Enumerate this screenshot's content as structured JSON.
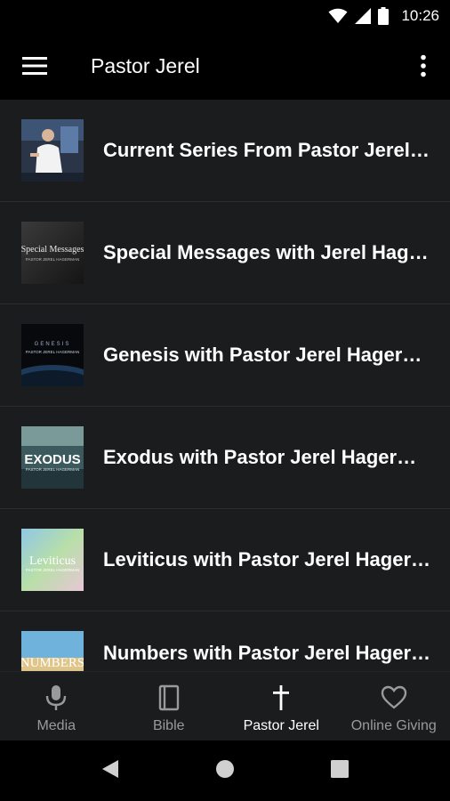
{
  "status_bar": {
    "time": "10:26",
    "icons": [
      "wifi-icon",
      "cell-signal-icon",
      "battery-icon"
    ]
  },
  "app_bar": {
    "title": "Pastor Jerel",
    "menu_icon": "hamburger-menu-icon",
    "overflow_icon": "more-vert-icon"
  },
  "list": {
    "items": [
      {
        "title": "Current Series From Pastor Jerel Hagerman",
        "thumb": "speaker-photo"
      },
      {
        "title": "Special Messages with Jerel Hagerman",
        "thumb": "special-messages-art",
        "thumb_text": "Special Messages",
        "thumb_sub": "PASTOR JEREL HAGERMAN"
      },
      {
        "title": "Genesis with Pastor Jerel Hagerman",
        "thumb": "genesis-art",
        "thumb_text": "GENESIS",
        "thumb_sub": "PASTOR JEREL HAGERMAN"
      },
      {
        "title": "Exodus with Pastor Jerel Hagerman",
        "thumb": "exodus-art",
        "thumb_text": "EXODUS",
        "thumb_sub": "PASTOR JEREL HAGERMAN"
      },
      {
        "title": "Leviticus with Pastor Jerel Hagerman",
        "thumb": "leviticus-art",
        "thumb_text": "Leviticus",
        "thumb_sub": "PASTOR JEREL HAGERMAN"
      },
      {
        "title": "Numbers with Pastor Jerel Hagerman",
        "thumb": "numbers-art",
        "thumb_text": "NUMBERS"
      }
    ]
  },
  "bottom_nav": {
    "tabs": [
      {
        "label": "Media",
        "icon": "microphone-icon",
        "active": false
      },
      {
        "label": "Bible",
        "icon": "book-icon",
        "active": false
      },
      {
        "label": "Pastor Jerel",
        "icon": "cross-icon",
        "active": true
      },
      {
        "label": "Online Giving",
        "icon": "heart-icon",
        "active": false
      }
    ]
  },
  "system_nav": {
    "icons": [
      "back-icon",
      "home-icon",
      "recents-icon"
    ]
  },
  "colors": {
    "background": "#1b1c1e",
    "app_bar": "#000000",
    "active_tab": "#ffffff",
    "inactive_tab": "#9a9a9a"
  }
}
